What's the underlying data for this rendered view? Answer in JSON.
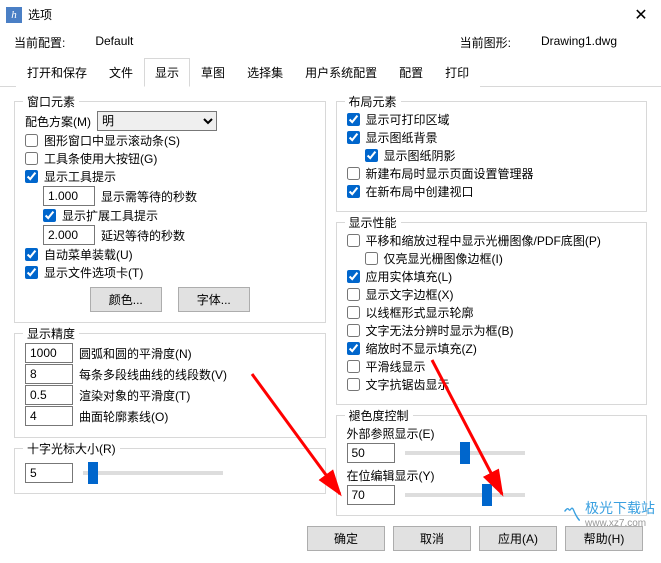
{
  "window": {
    "title": "选项",
    "close": "✕",
    "icon": "h"
  },
  "info": {
    "current_profile_label": "当前配置:",
    "current_profile_value": "Default",
    "current_drawing_label": "当前图形:",
    "current_drawing_value": "Drawing1.dwg"
  },
  "tabs": [
    "打开和保存",
    "文件",
    "显示",
    "草图",
    "选择集",
    "用户系统配置",
    "配置",
    "打印"
  ],
  "active_tab_index": 2,
  "left": {
    "window_elements": {
      "title": "窗口元素",
      "color_scheme_label": "配色方案(M)",
      "color_scheme_value": "明",
      "show_scrollbars": "图形窗口中显示滚动条(S)",
      "large_buttons": "工具条使用大按钮(G)",
      "show_tooltips": "显示工具提示",
      "tooltip_delay_value": "1.000",
      "tooltip_delay_label": "显示需等待的秒数",
      "show_ext_tooltips": "显示扩展工具提示",
      "ext_delay_value": "2.000",
      "ext_delay_label": "延迟等待的秒数",
      "auto_menu": "自动菜单装载(U)",
      "show_file_tabs": "显示文件选项卡(T)",
      "color_btn": "颜色...",
      "font_btn": "字体..."
    },
    "display_precision": {
      "title": "显示精度",
      "v1": "1000",
      "l1": "圆弧和圆的平滑度(N)",
      "v2": "8",
      "l2": "每条多段线曲线的线段数(V)",
      "v3": "0.5",
      "l3": "渲染对象的平滑度(T)",
      "v4": "4",
      "l4": "曲面轮廓素线(O)"
    },
    "cursor": {
      "title": "十字光标大小(R)",
      "value": "5"
    }
  },
  "right": {
    "layout_elements": {
      "title": "布局元素",
      "show_printable": "显示可打印区域",
      "show_paper_bg": "显示图纸背景",
      "show_paper_shadow": "显示图纸阴影",
      "page_setup_mgr": "新建布局时显示页面设置管理器",
      "create_viewport": "在新布局中创建视口"
    },
    "display_perf": {
      "title": "显示性能",
      "pan_zoom_raster": "平移和缩放过程中显示光栅图像/PDF底图(P)",
      "highlight_boundary": "仅亮显光栅图像边框(I)",
      "apply_solid_fill": "应用实体填充(L)",
      "show_text_boundary": "显示文字边框(X)",
      "wireframe_display": "以线框形式显示轮廓",
      "text_fail_frame": "文字无法分辨时显示为框(B)",
      "zoom_no_fill": "缩放时不显示填充(Z)",
      "smooth_line": "平滑线显示",
      "text_antialias": "文字抗锯齿显示"
    },
    "fade_control": {
      "title": "褪色度控制",
      "xref_label": "外部参照显示(E)",
      "xref_value": "50",
      "inplace_label": "在位编辑显示(Y)",
      "inplace_value": "70"
    }
  },
  "buttons": {
    "ok": "确定",
    "cancel": "取消",
    "apply": "应用(A)",
    "help": "帮助(H)"
  },
  "watermark": {
    "name": "极光下载站",
    "url": "www.xz7.com"
  }
}
